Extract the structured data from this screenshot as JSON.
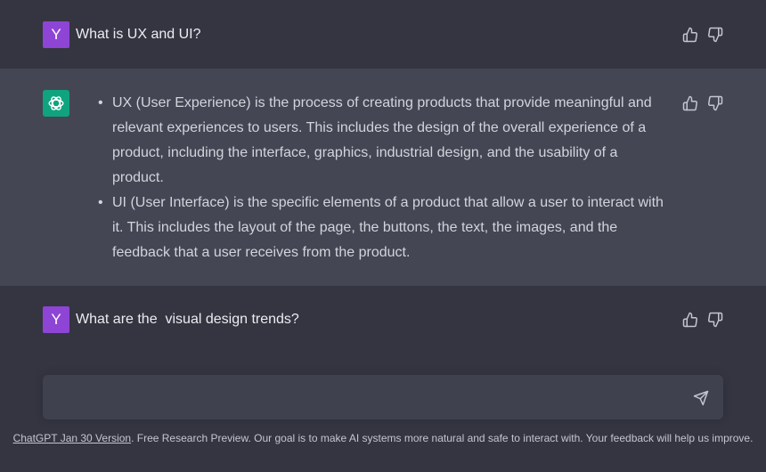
{
  "conversation": {
    "user_avatar_letter": "Y",
    "messages": [
      {
        "role": "user",
        "text": "What is UX and UI?"
      },
      {
        "role": "assistant",
        "bullets": [
          "UX (User Experience) is the process of creating products that provide meaningful and relevant experiences to users. This includes the design of the overall experience of a product, including the interface, graphics, industrial design, and the usability of a product.",
          "UI (User Interface) is the specific elements of a product that allow a user to interact with it. This includes the layout of the page, the buttons, the text, the images, and the feedback that a user receives from the product."
        ]
      },
      {
        "role": "user",
        "text": "What are the  visual design trends?"
      }
    ]
  },
  "composer": {
    "placeholder": "",
    "value": ""
  },
  "footer": {
    "version_link": "ChatGPT Jan 30 Version",
    "text": ". Free Research Preview. Our goal is to make AI systems more natural and safe to interact with. Your feedback will help us improve."
  },
  "colors": {
    "background": "#343541",
    "assistant_row": "#444654",
    "user_avatar": "#8e44d4",
    "assistant_avatar": "#10a37f",
    "composer": "#40414f"
  },
  "icons": {
    "like": "thumbs-up-icon",
    "dislike": "thumbs-down-icon",
    "send": "send-icon",
    "assistant_logo": "openai-logo-icon"
  }
}
